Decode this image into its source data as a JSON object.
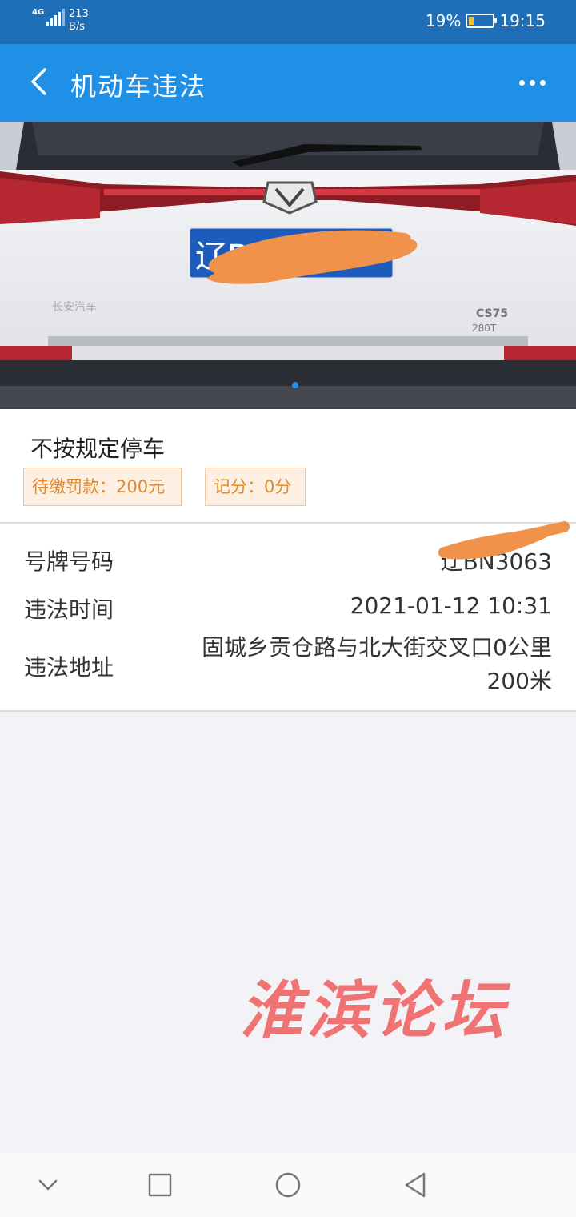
{
  "status_bar": {
    "network": "4G",
    "speed_value": "213",
    "speed_unit": "B/s",
    "battery": "19%",
    "time": "19:15"
  },
  "header": {
    "title": "机动车违法",
    "back_icon": "chevron-left-icon",
    "more_icon": "more-dots-icon"
  },
  "violation": {
    "type": "不按规定停车",
    "fine_tag": "待缴罚款：200元",
    "points_tag": "记分：0分"
  },
  "details": {
    "plate_label": "号牌号码",
    "plate_value": "辽BN3063",
    "time_label": "违法时间",
    "time_value": "2021-01-12 10:31",
    "address_label": "违法地址",
    "address_value": "固城乡贡仓路与北大街交叉口0公里200米"
  },
  "photo": {
    "plate_text": "辽B"
  },
  "watermark": "淮滨论坛",
  "colors": {
    "status_bar": "#1e6fb7",
    "title_bar": "#2090e6",
    "tag_text": "#e08a2e",
    "tag_bg": "#fdf0e2",
    "watermark": "#ef7373",
    "scribble": "#f0924a"
  }
}
